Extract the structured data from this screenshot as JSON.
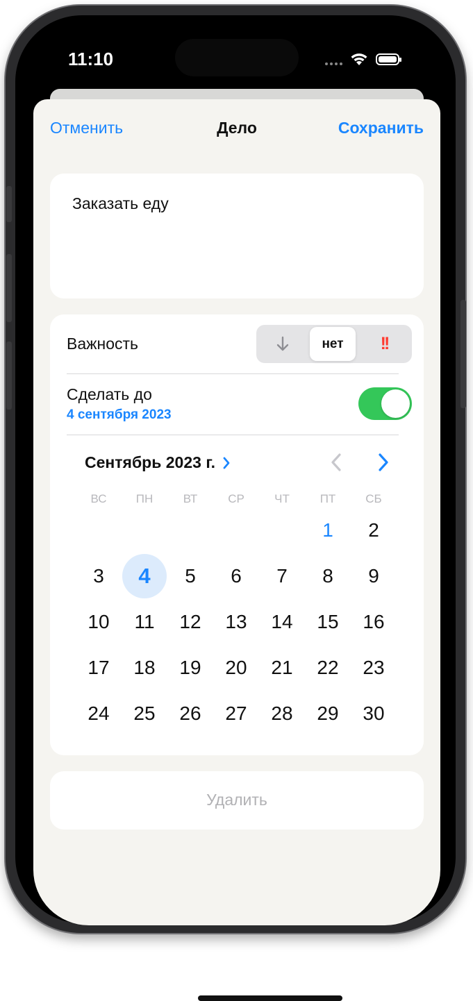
{
  "status": {
    "time": "11:10"
  },
  "nav": {
    "cancel": "Отменить",
    "title": "Дело",
    "save": "Сохранить"
  },
  "task": {
    "text": "Заказать еду"
  },
  "importance": {
    "label": "Важность",
    "options": [
      "↓",
      "нет",
      "!!"
    ],
    "selected": "нет"
  },
  "deadline": {
    "label": "Сделать до",
    "date": "4 сентября 2023",
    "enabled": true
  },
  "calendar": {
    "month": "Сентябрь 2023 г.",
    "weekdays": [
      "ВС",
      "ПН",
      "ВТ",
      "СР",
      "ЧТ",
      "ПТ",
      "СБ"
    ],
    "days": [
      "1",
      "2",
      "3",
      "4",
      "5",
      "6",
      "7",
      "8",
      "9",
      "10",
      "11",
      "12",
      "13",
      "14",
      "15",
      "16",
      "17",
      "18",
      "19",
      "20",
      "21",
      "22",
      "23",
      "24",
      "25",
      "26",
      "27",
      "28",
      "29",
      "30"
    ],
    "selected": "4",
    "today": "1"
  },
  "delete": {
    "label": "Удалить"
  },
  "colors": {
    "accent": "#1a86ff",
    "toggle_on": "#34c759",
    "danger": "#ff3b30",
    "sheet_bg": "#f5f4f0"
  }
}
